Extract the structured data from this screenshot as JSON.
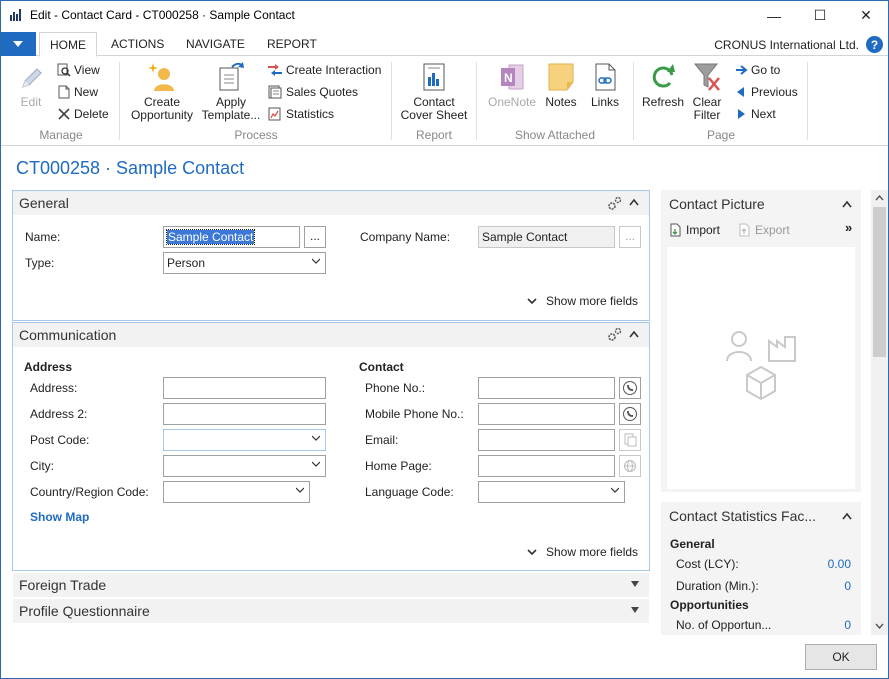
{
  "window": {
    "title": "Edit - Contact Card - CT000258 · Sample Contact",
    "minimize": "—",
    "maximize": "☐",
    "close": "✕"
  },
  "ribbon_tabs": [
    "HOME",
    "ACTIONS",
    "NAVIGATE",
    "REPORT"
  ],
  "company": "CRONUS International Ltd.",
  "help": "?",
  "ribbon": {
    "manage": {
      "label": "Manage",
      "edit": "Edit",
      "view": "View",
      "new": "New",
      "delete": "Delete"
    },
    "process": {
      "label": "Process",
      "create_opportunity": [
        "Create",
        "Opportunity"
      ],
      "apply_template": [
        "Apply",
        "Template..."
      ],
      "create_interaction": "Create Interaction",
      "sales_quotes": "Sales Quotes",
      "statistics": "Statistics"
    },
    "report": {
      "label": "Report",
      "contact_cover_sheet": [
        "Contact",
        "Cover Sheet"
      ]
    },
    "show_attached": {
      "label": "Show Attached",
      "onenote": "OneNote",
      "notes": "Notes",
      "links": "Links"
    },
    "page": {
      "label": "Page",
      "refresh": "Refresh",
      "clear_filter": [
        "Clear",
        "Filter"
      ],
      "go_to": "Go to",
      "previous": "Previous",
      "next": "Next"
    }
  },
  "page_title": "CT000258 · Sample Contact",
  "general": {
    "header": "General",
    "name_label": "Name:",
    "name_value": "Sample Contact",
    "assist": "...",
    "company_label": "Company Name:",
    "company_value": "Sample Contact",
    "type_label": "Type:",
    "type_value": "Person",
    "show_more": "Show more fields"
  },
  "communication": {
    "header": "Communication",
    "address_heading": "Address",
    "address_label": "Address:",
    "address2_label": "Address 2:",
    "post_code_label": "Post Code:",
    "city_label": "City:",
    "country_label": "Country/Region Code:",
    "show_map": "Show Map",
    "contact_heading": "Contact",
    "phone_label": "Phone No.:",
    "mobile_label": "Mobile Phone No.:",
    "email_label": "Email:",
    "home_page_label": "Home Page:",
    "language_label": "Language Code:",
    "show_more": "Show more fields"
  },
  "foreign_trade": {
    "header": "Foreign Trade"
  },
  "profile": {
    "header": "Profile Questionnaire"
  },
  "contact_picture": {
    "title": "Contact Picture",
    "import": "Import",
    "export": "Export",
    "more": "»"
  },
  "contact_statistics": {
    "title": "Contact Statistics Fac...",
    "general_heading": "General",
    "cost_label": "Cost (LCY):",
    "cost_value": "0.00",
    "duration_label": "Duration (Min.):",
    "duration_value": "0",
    "opportunities_heading": "Opportunities",
    "no_opps_label": "No. of Opportun...",
    "no_opps_value": "0"
  },
  "ok": "OK",
  "colors": {
    "accent": "#1f6bc2",
    "border_focus": "#a9c7e8"
  }
}
